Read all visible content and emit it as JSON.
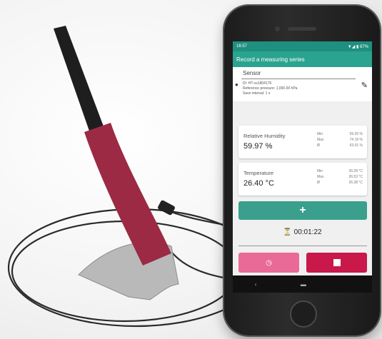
{
  "statusbar": {
    "time": "16:57",
    "icons": "▼◢ ▮ 87%"
  },
  "appbar": {
    "title": "Record a measuring series"
  },
  "sensor": {
    "title": "Sensor",
    "id_line": "ID: HT-xx1804176",
    "pressure_line": "Reference pressure: 1,000.00 hPa",
    "interval_line": "Save interval: 1 s"
  },
  "humidity": {
    "label": "Relative Humidity",
    "value": "59.97 %",
    "stat_labels": [
      "Min",
      "Max",
      "Ø"
    ],
    "stat_values": [
      "59.20 %",
      "74.19 %",
      "63.01 %"
    ]
  },
  "temperature": {
    "label": "Temperature",
    "value": "26.40 °C",
    "stat_labels": [
      "Min",
      "Max",
      "Ø"
    ],
    "stat_values": [
      "26.28 °C",
      "26.53 °C",
      "26.38 °C"
    ]
  },
  "actions": {
    "add_label": "+",
    "timer": "00:01:22",
    "timer_icon": "⏳",
    "pause_icon": "◷"
  },
  "navbar": {
    "back": "‹",
    "home": "▬"
  },
  "colors": {
    "accent": "#2aa38f",
    "pink": "#ea6a97",
    "crimson": "#c9184a",
    "sensor_body": "#9c2a45"
  }
}
